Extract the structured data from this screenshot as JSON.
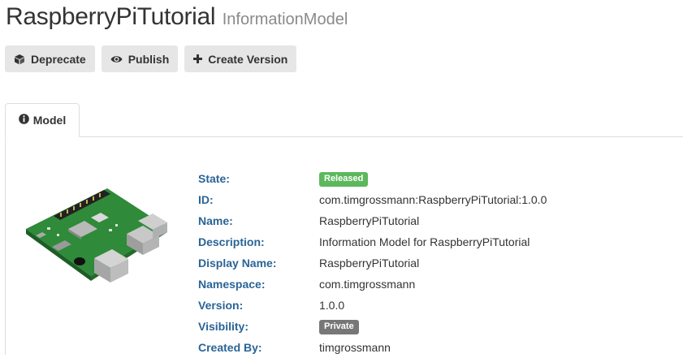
{
  "header": {
    "title": "RaspberryPiTutorial",
    "subtitle": "InformationModel"
  },
  "toolbar": {
    "deprecate_label": "Deprecate",
    "publish_label": "Publish",
    "create_version_label": "Create Version"
  },
  "tabs": [
    {
      "label": "Model",
      "icon": "info-circle-icon"
    }
  ],
  "details": {
    "state": {
      "label": "State:",
      "value": "Released",
      "color": "#5cb85c"
    },
    "id": {
      "label": "ID:",
      "value": "com.timgrossmann:RaspberryPiTutorial:1.0.0"
    },
    "name": {
      "label": "Name:",
      "value": "RaspberryPiTutorial"
    },
    "description": {
      "label": "Description:",
      "value": "Information Model for RaspberryPiTutorial"
    },
    "display_name": {
      "label": "Display Name:",
      "value": "RaspberryPiTutorial"
    },
    "namespace": {
      "label": "Namespace:",
      "value": "com.timgrossmann"
    },
    "version": {
      "label": "Version:",
      "value": "1.0.0"
    },
    "visibility": {
      "label": "Visibility:",
      "value": "Private",
      "color": "#777777"
    },
    "created_by": {
      "label": "Created By:",
      "value": "timgrossmann"
    }
  },
  "colors": {
    "label_blue": "#2a6496",
    "button_bg": "#e6e6e6"
  }
}
